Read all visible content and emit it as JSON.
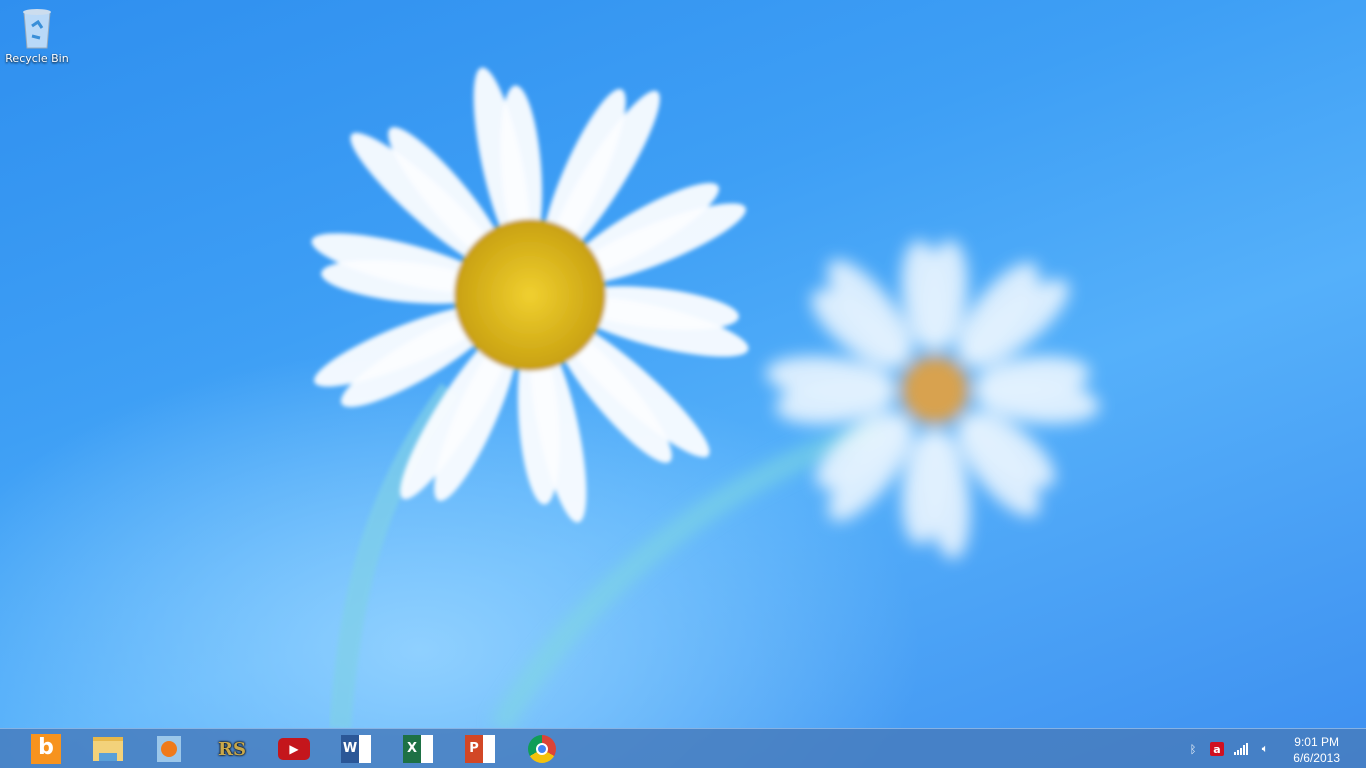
{
  "desktop": {
    "icons": [
      {
        "label": "Recycle Bin",
        "icon": "recycle-bin-icon"
      }
    ]
  },
  "taskbar": {
    "pinned": [
      {
        "name": "bing",
        "icon": "bing-icon",
        "color": "#f7931e"
      },
      {
        "name": "file-explorer",
        "icon": "folder-icon",
        "color": "#f3d27a"
      },
      {
        "name": "media-player",
        "icon": "media-player-icon",
        "color": "#f07a1a"
      },
      {
        "name": "runescape",
        "icon": "runescape-icon",
        "text": "RS"
      },
      {
        "name": "youtube",
        "icon": "youtube-icon",
        "color": "#c4161c"
      },
      {
        "name": "word",
        "icon": "word-icon",
        "text": "W",
        "color": "#2b5797"
      },
      {
        "name": "excel",
        "icon": "excel-icon",
        "text": "X",
        "color": "#1e7145"
      },
      {
        "name": "powerpoint",
        "icon": "powerpoint-icon",
        "text": "P",
        "color": "#d24726"
      },
      {
        "name": "chrome",
        "icon": "chrome-icon"
      }
    ],
    "tray": [
      "bluetooth-icon",
      "avira-icon",
      "network-signal-icon",
      "volume-icon"
    ],
    "clock": {
      "time": "9:01 PM",
      "date": "6/6/2013"
    }
  }
}
